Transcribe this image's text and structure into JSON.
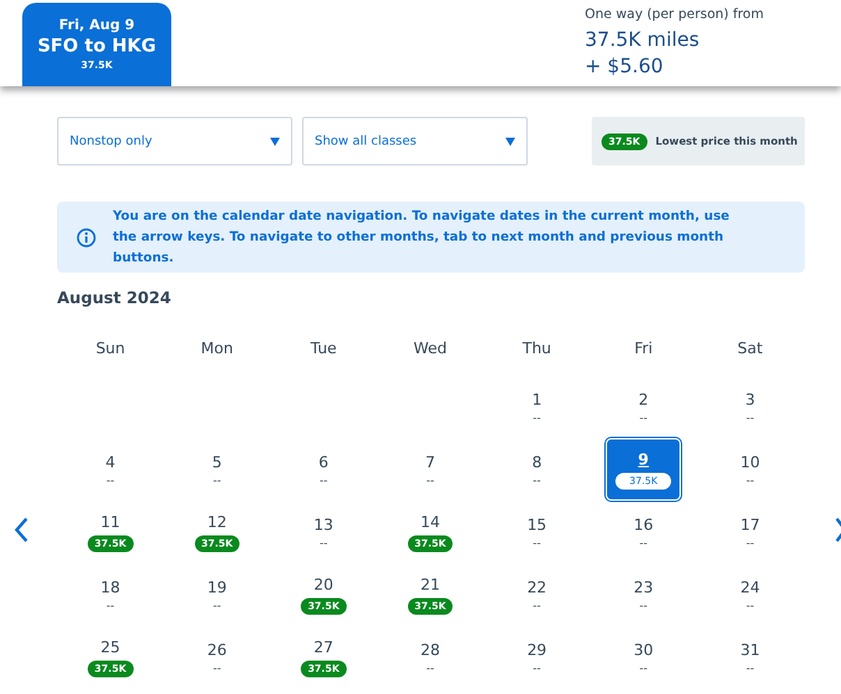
{
  "header": {
    "tab": {
      "date": "Fri, Aug 9",
      "route": "SFO to HKG",
      "price": "37.5K",
      "selected": true
    },
    "fare_label": "One way (per person) from",
    "miles": "37.5K miles",
    "fee": "+ $5.60"
  },
  "filters": [
    {
      "value": "Nonstop only"
    },
    {
      "value": "Show all classes"
    }
  ],
  "legend": {
    "badge": "37.5K",
    "label": "Lowest price this month"
  },
  "notice": "You are on the calendar date navigation. To navigate dates in the current month, use the arrow keys. To navigate to other months, tab to next month and previous month buttons.",
  "calendar": {
    "month": "August 2024",
    "weekdays": [
      "Sun",
      "Mon",
      "Tue",
      "Wed",
      "Thu",
      "Fri",
      "Sat"
    ],
    "weeks": [
      [
        {
          "day": "1",
          "price": "--",
          "kind": "none",
          "selected": false
        },
        {
          "day": "2",
          "price": "--",
          "kind": "none",
          "selected": false
        },
        {
          "day": "3",
          "price": "--",
          "kind": "none",
          "selected": false
        }
      ],
      [
        {
          "day": "4",
          "price": "--",
          "kind": "none",
          "selected": false
        },
        {
          "day": "5",
          "price": "--",
          "kind": "none",
          "selected": false
        },
        {
          "day": "6",
          "price": "--",
          "kind": "none",
          "selected": false
        },
        {
          "day": "7",
          "price": "--",
          "kind": "none",
          "selected": false
        },
        {
          "day": "8",
          "price": "--",
          "kind": "none",
          "selected": false
        },
        {
          "day": "9",
          "price": "37.5K",
          "kind": "fare",
          "selected": true
        },
        {
          "day": "10",
          "price": "--",
          "kind": "none",
          "selected": false
        }
      ],
      [
        {
          "day": "11",
          "price": "37.5K",
          "kind": "fare",
          "selected": false
        },
        {
          "day": "12",
          "price": "37.5K",
          "kind": "fare",
          "selected": false
        },
        {
          "day": "13",
          "price": "--",
          "kind": "none",
          "selected": false
        },
        {
          "day": "14",
          "price": "37.5K",
          "kind": "fare",
          "selected": false
        },
        {
          "day": "15",
          "price": "--",
          "kind": "none",
          "selected": false
        },
        {
          "day": "16",
          "price": "--",
          "kind": "none",
          "selected": false
        },
        {
          "day": "17",
          "price": "--",
          "kind": "none",
          "selected": false
        }
      ],
      [
        {
          "day": "18",
          "price": "--",
          "kind": "none",
          "selected": false
        },
        {
          "day": "19",
          "price": "--",
          "kind": "none",
          "selected": false
        },
        {
          "day": "20",
          "price": "37.5K",
          "kind": "fare",
          "selected": false
        },
        {
          "day": "21",
          "price": "37.5K",
          "kind": "fare",
          "selected": false
        },
        {
          "day": "22",
          "price": "--",
          "kind": "none",
          "selected": false
        },
        {
          "day": "23",
          "price": "--",
          "kind": "none",
          "selected": false
        },
        {
          "day": "24",
          "price": "--",
          "kind": "none",
          "selected": false
        }
      ],
      [
        {
          "day": "25",
          "price": "37.5K",
          "kind": "fare",
          "selected": false
        },
        {
          "day": "26",
          "price": "--",
          "kind": "none",
          "selected": false
        },
        {
          "day": "27",
          "price": "37.5K",
          "kind": "fare",
          "selected": false
        },
        {
          "day": "28",
          "price": "--",
          "kind": "none",
          "selected": false
        },
        {
          "day": "29",
          "price": "--",
          "kind": "none",
          "selected": false
        },
        {
          "day": "30",
          "price": "--",
          "kind": "none",
          "selected": false
        },
        {
          "day": "31",
          "price": "--",
          "kind": "none",
          "selected": false
        }
      ]
    ]
  }
}
